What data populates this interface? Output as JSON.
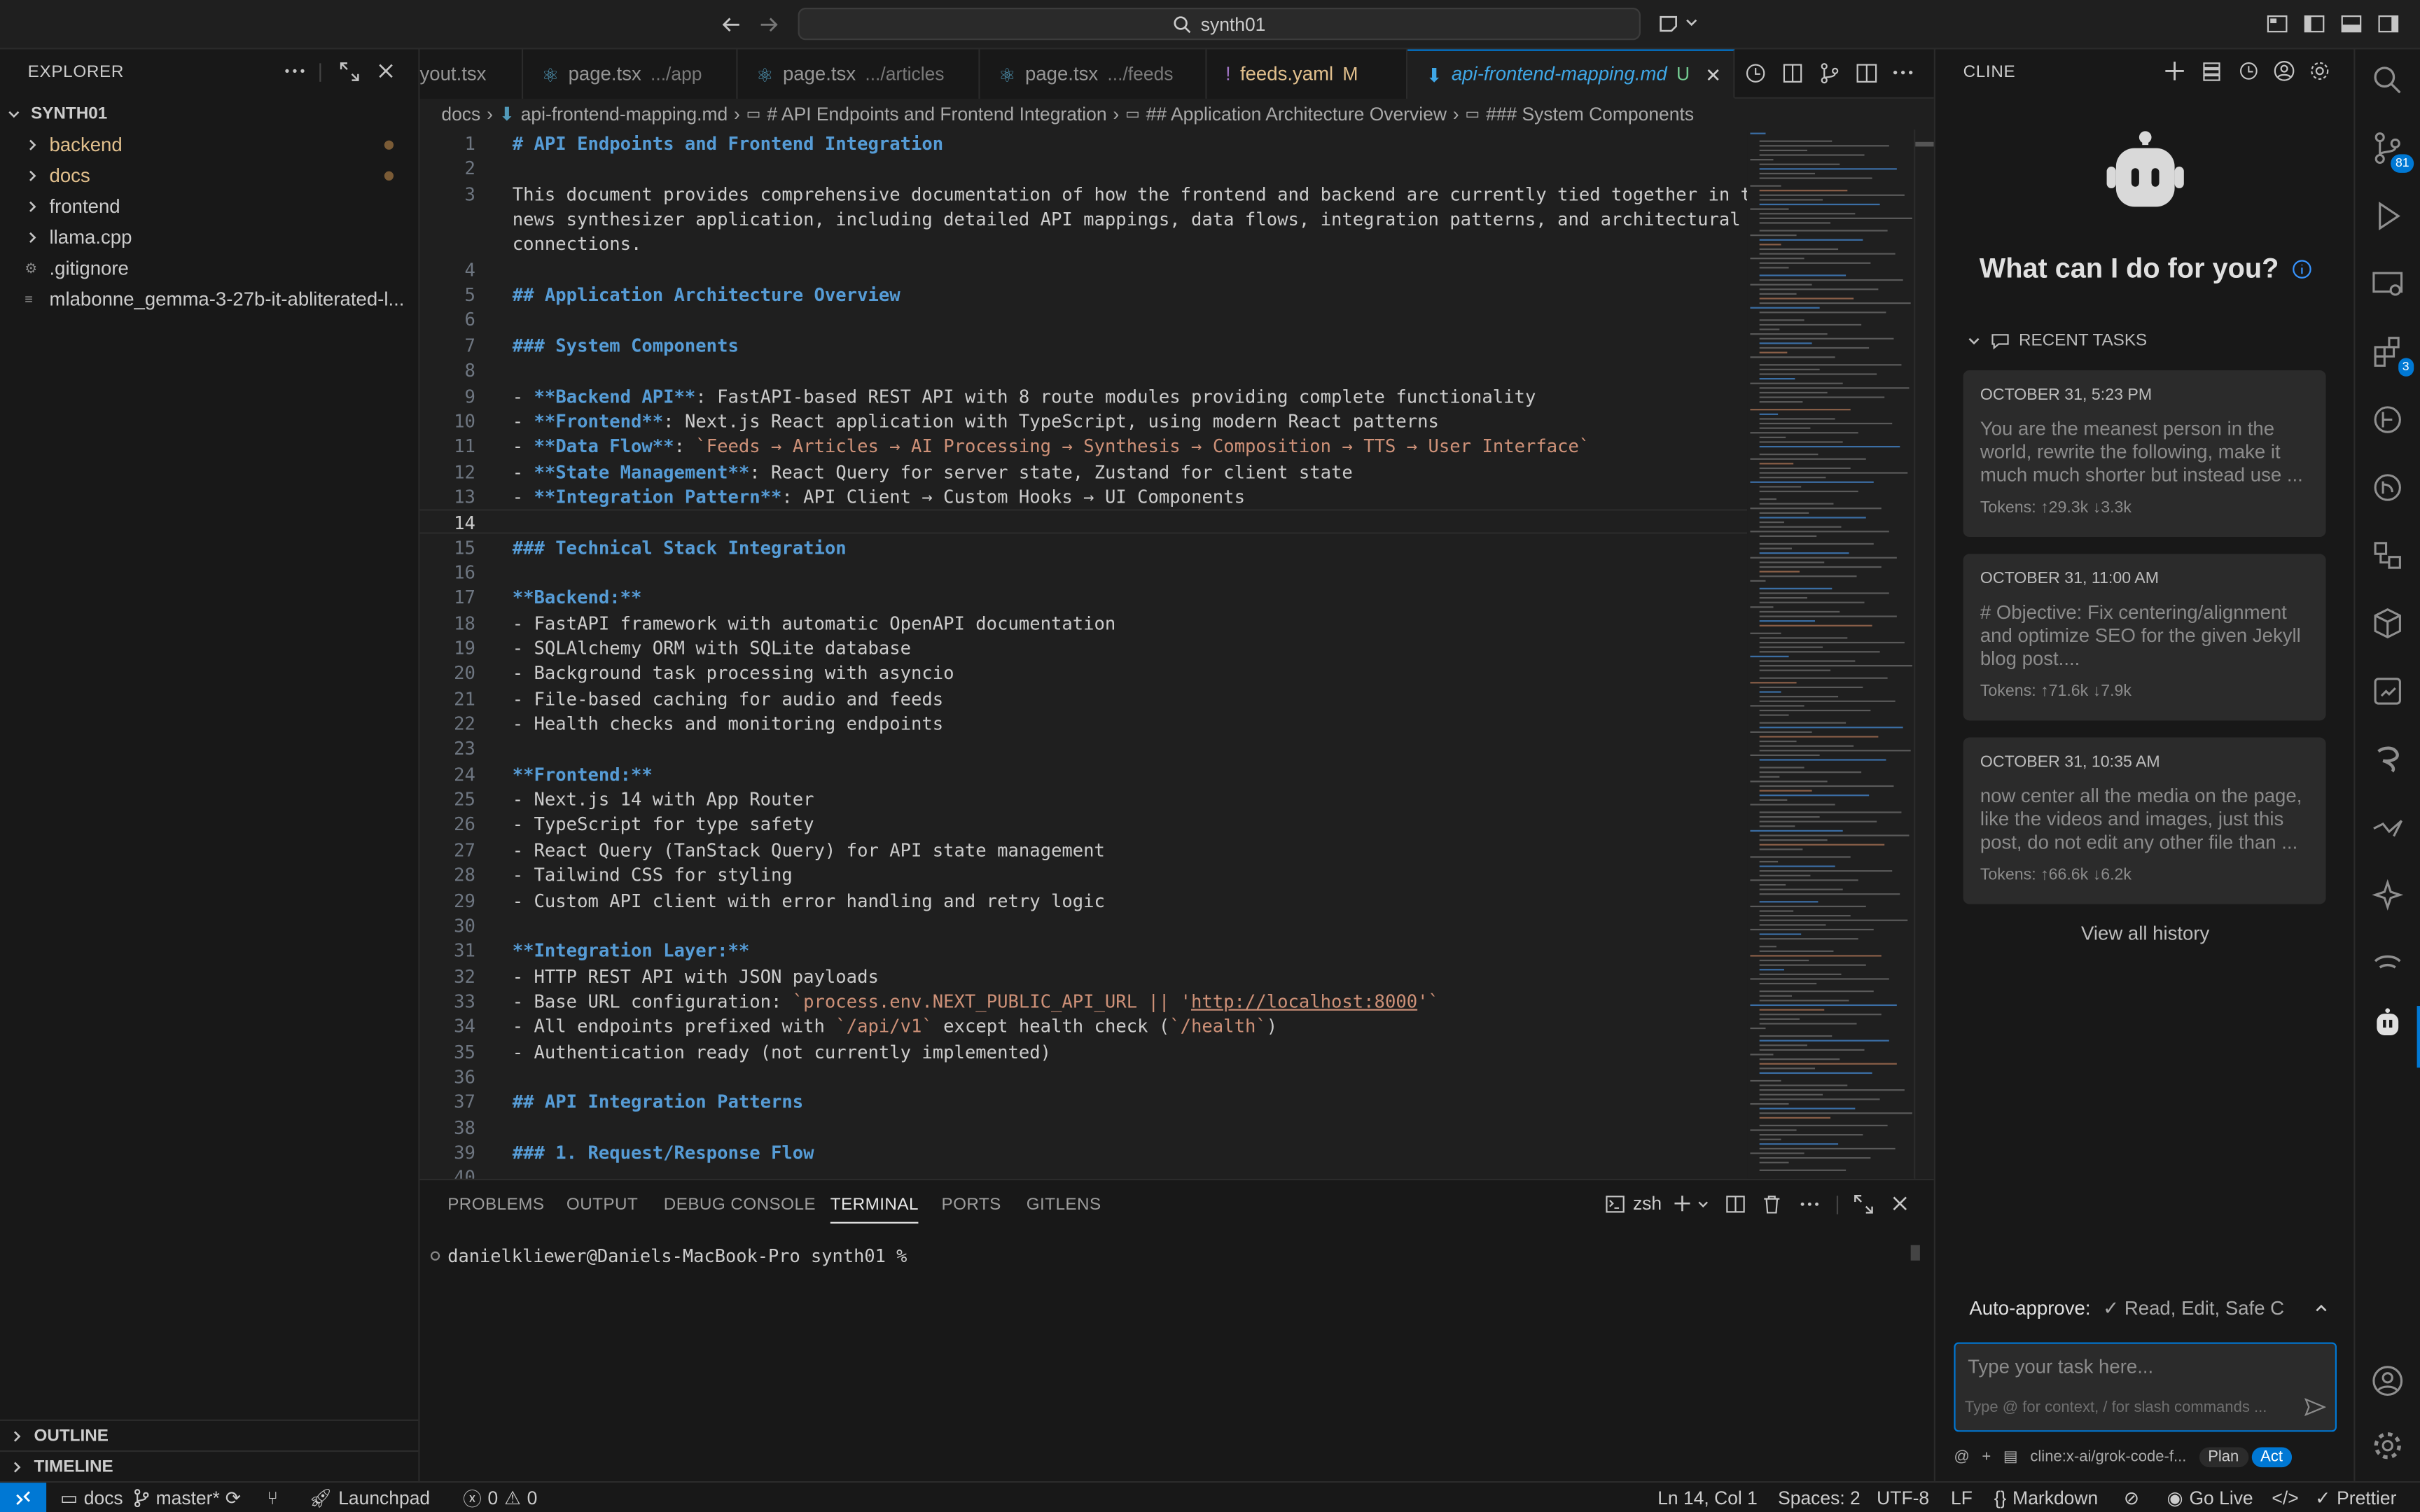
{
  "window": {
    "search_text": "synth01"
  },
  "explorer": {
    "title": "EXPLORER",
    "root": "SYNTH01",
    "items": [
      {
        "label": "backend",
        "type": "folder",
        "modified": true
      },
      {
        "label": "docs",
        "type": "folder",
        "modified": true
      },
      {
        "label": "frontend",
        "type": "folder",
        "modified": false
      },
      {
        "label": "llama.cpp",
        "type": "folder",
        "modified": false
      },
      {
        "label": ".gitignore",
        "type": "file",
        "modified": false
      },
      {
        "label": "mlabonne_gemma-3-27b-it-abliterated-l...",
        "type": "file",
        "modified": false
      }
    ],
    "outline": "OUTLINE",
    "timeline": "TIMELINE"
  },
  "tabs": [
    {
      "label": "yout.tsx",
      "desc": ""
    },
    {
      "label": "page.tsx",
      "desc": ".../app"
    },
    {
      "label": "page.tsx",
      "desc": ".../articles"
    },
    {
      "label": "page.tsx",
      "desc": ".../feeds"
    },
    {
      "label": "feeds.yaml",
      "desc": "M"
    },
    {
      "label": "api-frontend-mapping.md",
      "desc": "U"
    }
  ],
  "breadcrumbs": [
    "docs",
    "api-frontend-mapping.md",
    "# API Endpoints and Frontend Integration",
    "## Application Architecture Overview",
    "### System Components"
  ],
  "editor": {
    "current_line": 14,
    "lines": [
      "# API Endpoints and Frontend Integration",
      "",
      "This document provides comprehensive documentation of how the frontend and backend are currently tied together in the",
      "news synthesizer application, including detailed API mappings, data flows, integration patterns, and architectural",
      "connections.",
      "",
      "## Application Architecture Overview",
      "",
      "### System Components",
      "",
      "- **Backend API**: FastAPI-based REST API with 8 route modules providing complete functionality",
      "- **Frontend**: Next.js React application with TypeScript, using modern React patterns",
      "- **Data Flow**: `Feeds → Articles → AI Processing → Synthesis → Composition → TTS → User Interface`",
      "- **State Management**: React Query for server state, Zustand for client state",
      "- **Integration Pattern**: API Client → Custom Hooks → UI Components",
      "",
      "### Technical Stack Integration",
      "",
      "**Backend:**",
      "- FastAPI framework with automatic OpenAPI documentation",
      "- SQLAlchemy ORM with SQLite database",
      "- Background task processing with asyncio",
      "- File-based caching for audio and feeds",
      "- Health checks and monitoring endpoints",
      "",
      "**Frontend:**",
      "- Next.js 14 with App Router",
      "- TypeScript for type safety",
      "- React Query (TanStack Query) for API state management",
      "- Tailwind CSS for styling",
      "- Custom API client with error handling and retry logic",
      "",
      "**Integration Layer:**",
      "- HTTP REST API with JSON payloads",
      "- Base URL configuration: `process.env.NEXT_PUBLIC_API_URL || 'http://localhost:8000'`",
      "- All endpoints prefixed with `/api/v1` except health check (`/health`)",
      "- Authentication ready (not currently implemented)",
      "",
      "## API Integration Patterns",
      "",
      "### 1. Request/Response Flow",
      ""
    ]
  },
  "panel": {
    "tabs": [
      "PROBLEMS",
      "OUTPUT",
      "DEBUG CONSOLE",
      "TERMINAL",
      "PORTS",
      "GITLENS"
    ],
    "active": "TERMINAL",
    "shell": "zsh",
    "prompt": "danielkliewer@Daniels-MacBook-Pro synth01 %"
  },
  "cline": {
    "title": "CLINE",
    "heading": "What can I do for you?",
    "recent_label": "RECENT TASKS",
    "tasks": [
      {
        "date": "OCTOBER 31, 5:23 PM",
        "text": "You are the meanest person in the world, rewrite the following, make it much much shorter but instead use ...",
        "tokens": "Tokens: ↑29.3k ↓3.3k"
      },
      {
        "date": "OCTOBER 31, 11:00 AM",
        "text": "# Objective: Fix centering/alignment and optimize SEO for the given Jekyll blog post....",
        "tokens": "Tokens: ↑71.6k ↓7.9k"
      },
      {
        "date": "OCTOBER 31, 10:35 AM",
        "text": "now center all the media on the page, like the videos and images, just this post, do not edit any other file than ...",
        "tokens": "Tokens: ↑66.6k ↓6.2k"
      }
    ],
    "view_all": "View all history",
    "auto_approve_label": "Auto-approve:",
    "auto_approve_value": "✓ Read, Edit, Safe C",
    "input_placeholder": "Type your task here...",
    "input_hint": "Type @ for context, / for slash commands ...",
    "model": "cline:x-ai/grok-code-f...",
    "plan": "Plan",
    "act": "Act"
  },
  "activity_badges": {
    "source_control": "81",
    "extensions": "3"
  },
  "statusbar": {
    "folder": "docs",
    "branch": "master*",
    "launchpad": "Launchpad",
    "errors": "0",
    "warnings": "0",
    "position": "Ln 14, Col 1",
    "spaces": "Spaces: 2",
    "encoding": "UTF-8",
    "eol": "LF",
    "language": "Markdown",
    "golive": "Go Live",
    "prettier": "Prettier"
  },
  "colors": {
    "accent": "#0078d4",
    "heading": "#569cd6",
    "code_string": "#ce9178",
    "background": "#1f1f1f",
    "sidebar": "#181818"
  }
}
